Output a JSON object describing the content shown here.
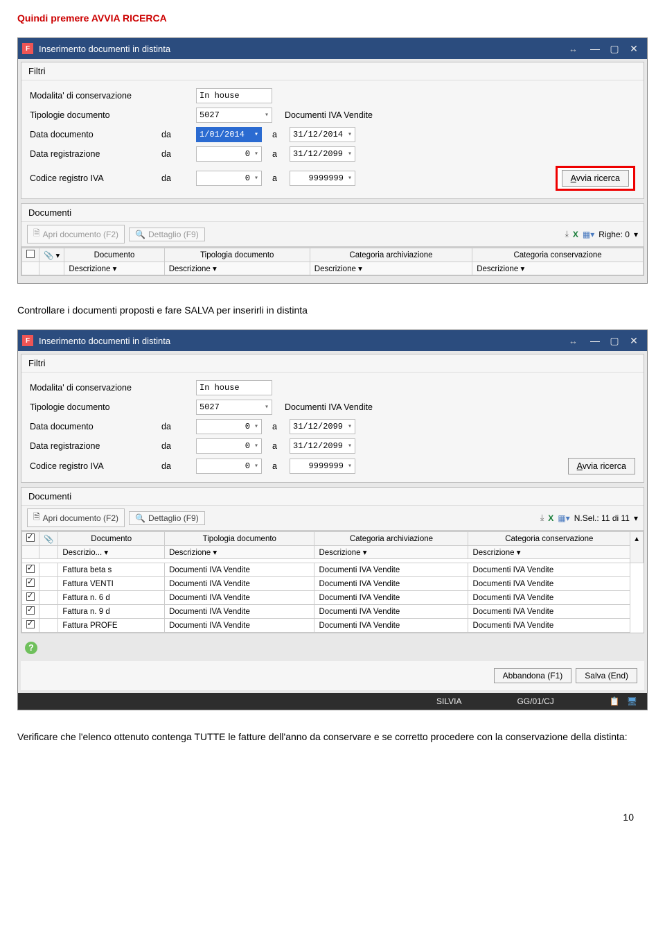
{
  "doc": {
    "text1": "Quindi premere AVVIA RICERCA",
    "text2": "Controllare i documenti proposti e fare SALVA per inserirli in distinta",
    "text3": "Verificare che l'elenco ottenuto contenga TUTTE le fatture dell'anno da conservare e se corretto procedere con la conservazione della distinta:",
    "pagenum": "10"
  },
  "window": {
    "title": "Inserimento documenti in distinta",
    "panel_filtri": "Filtri",
    "panel_documenti": "Documenti",
    "labels": {
      "modalita": "Modalita' di conservazione",
      "tipologie": "Tipologie documento",
      "data_doc": "Data documento",
      "data_reg": "Data registrazione",
      "codice_iva": "Codice registro IVA",
      "da": "da",
      "a": "a"
    },
    "iva_label": "Documenti IVA Vendite",
    "btn_search": "Avvia ricerca",
    "btn_search_accel": "A",
    "toolbar": {
      "apri": "Apri documento (F2)",
      "dettaglio": "Dettaglio (F9)",
      "righe0": "Righe: 0",
      "nsel": "N.Sel.: 11 di 11"
    },
    "cols": {
      "documento": "Documento",
      "tipologia": "Tipologia documento",
      "cat_arch": "Categoria archiviazione",
      "cat_cons": "Categoria conservazione",
      "descrizione": "Descrizione",
      "descrizio": "Descrizio..."
    },
    "footer": {
      "abbandona": "Abbandona (F1)",
      "salva": "Salva (End)"
    },
    "status": {
      "user": "SILVIA",
      "code": "GG/01/CJ"
    }
  },
  "win1": {
    "modalita": "In house",
    "tipologie": "5027",
    "data_doc_da": "1/01/2014",
    "data_doc_a": "31/12/2014",
    "data_reg_da": "0",
    "data_reg_a": "31/12/2099",
    "iva_da": "0",
    "iva_a": "9999999"
  },
  "win2": {
    "modalita": "In house",
    "tipologie": "5027",
    "data_doc_da": "0",
    "data_doc_a": "31/12/2099",
    "data_reg_da": "0",
    "data_reg_a": "31/12/2099",
    "iva_da": "0",
    "iva_a": "9999999",
    "rows": [
      {
        "doc": "Fattura beta s",
        "tip": "Documenti IVA Vendite",
        "arc": "Documenti IVA Vendite",
        "con": "Documenti IVA Vendite"
      },
      {
        "doc": "Fattura VENTI",
        "tip": "Documenti IVA Vendite",
        "arc": "Documenti IVA Vendite",
        "con": "Documenti IVA Vendite"
      },
      {
        "doc": "Fattura n. 6 d",
        "tip": "Documenti IVA Vendite",
        "arc": "Documenti IVA Vendite",
        "con": "Documenti IVA Vendite"
      },
      {
        "doc": "Fattura n. 9 d",
        "tip": "Documenti IVA Vendite",
        "arc": "Documenti IVA Vendite",
        "con": "Documenti IVA Vendite"
      },
      {
        "doc": "Fattura PROFE",
        "tip": "Documenti IVA Vendite",
        "arc": "Documenti IVA Vendite",
        "con": "Documenti IVA Vendite"
      }
    ]
  }
}
